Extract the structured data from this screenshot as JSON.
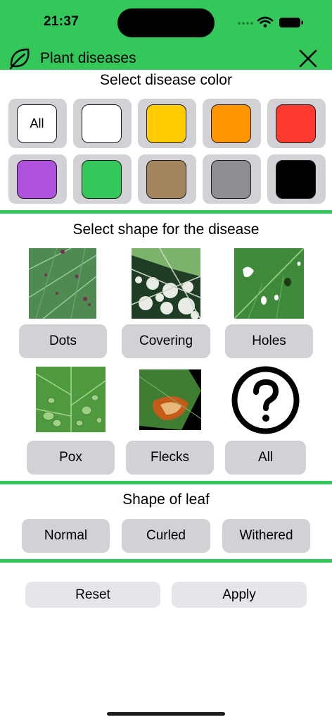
{
  "status_bar": {
    "time": "21:37"
  },
  "nav": {
    "title": "Plant diseases",
    "leaf_icon": "leaf-icon",
    "close_icon": "close-icon"
  },
  "colors_section": {
    "title": "Select disease color",
    "options": [
      {
        "label": "All",
        "color": "#ffffff"
      },
      {
        "label": "",
        "color": "#ffffff"
      },
      {
        "label": "",
        "color": "#ffcc00"
      },
      {
        "label": "",
        "color": "#ff9500"
      },
      {
        "label": "",
        "color": "#ff3b30"
      },
      {
        "label": "",
        "color": "#af52de"
      },
      {
        "label": "",
        "color": "#34c759"
      },
      {
        "label": "",
        "color": "#a2845e"
      },
      {
        "label": "",
        "color": "#8e8e93"
      },
      {
        "label": "",
        "color": "#000000"
      }
    ]
  },
  "shape_section": {
    "title": "Select shape for the disease",
    "options": [
      {
        "label": "Dots",
        "image": "leaf-dots-photo"
      },
      {
        "label": "Covering",
        "image": "leaf-covering-photo"
      },
      {
        "label": "Holes",
        "image": "leaf-holes-photo"
      },
      {
        "label": "Pox",
        "image": "leaf-pox-photo"
      },
      {
        "label": "Flecks",
        "image": "leaf-flecks-photo"
      },
      {
        "label": "All",
        "image": "question-mark-icon"
      }
    ]
  },
  "leaf_section": {
    "title": "Shape of leaf",
    "options": [
      "Normal",
      "Curled",
      "Withered"
    ]
  },
  "actions": {
    "reset": "Reset",
    "apply": "Apply"
  },
  "theme": {
    "accent": "#34c759",
    "chip_bg": "#d1d1d6",
    "button_bg": "#e5e5ea"
  }
}
